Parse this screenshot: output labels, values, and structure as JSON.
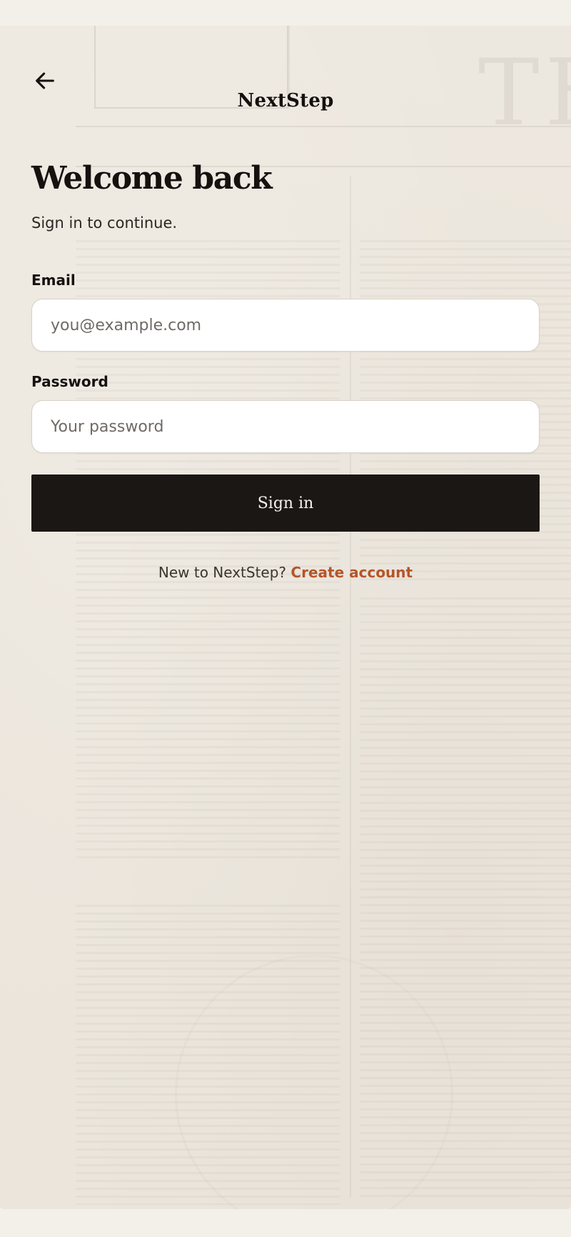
{
  "header": {
    "back_icon": "arrow-left-icon",
    "brand": "NextStep"
  },
  "main": {
    "title": "Welcome back",
    "subtitle": "Sign in to continue.",
    "email": {
      "label": "Email",
      "value": "",
      "placeholder": "you@example.com"
    },
    "password": {
      "label": "Password",
      "value": "",
      "placeholder": "Your password"
    },
    "sign_in_label": "Sign in",
    "footer_prompt": "New to NextStep?",
    "create_account_label": "Create account"
  },
  "colors": {
    "button_bg": "#1b1714",
    "link": "#b5552a",
    "text": "#14110f",
    "page_bg": "#f3f0ea"
  }
}
